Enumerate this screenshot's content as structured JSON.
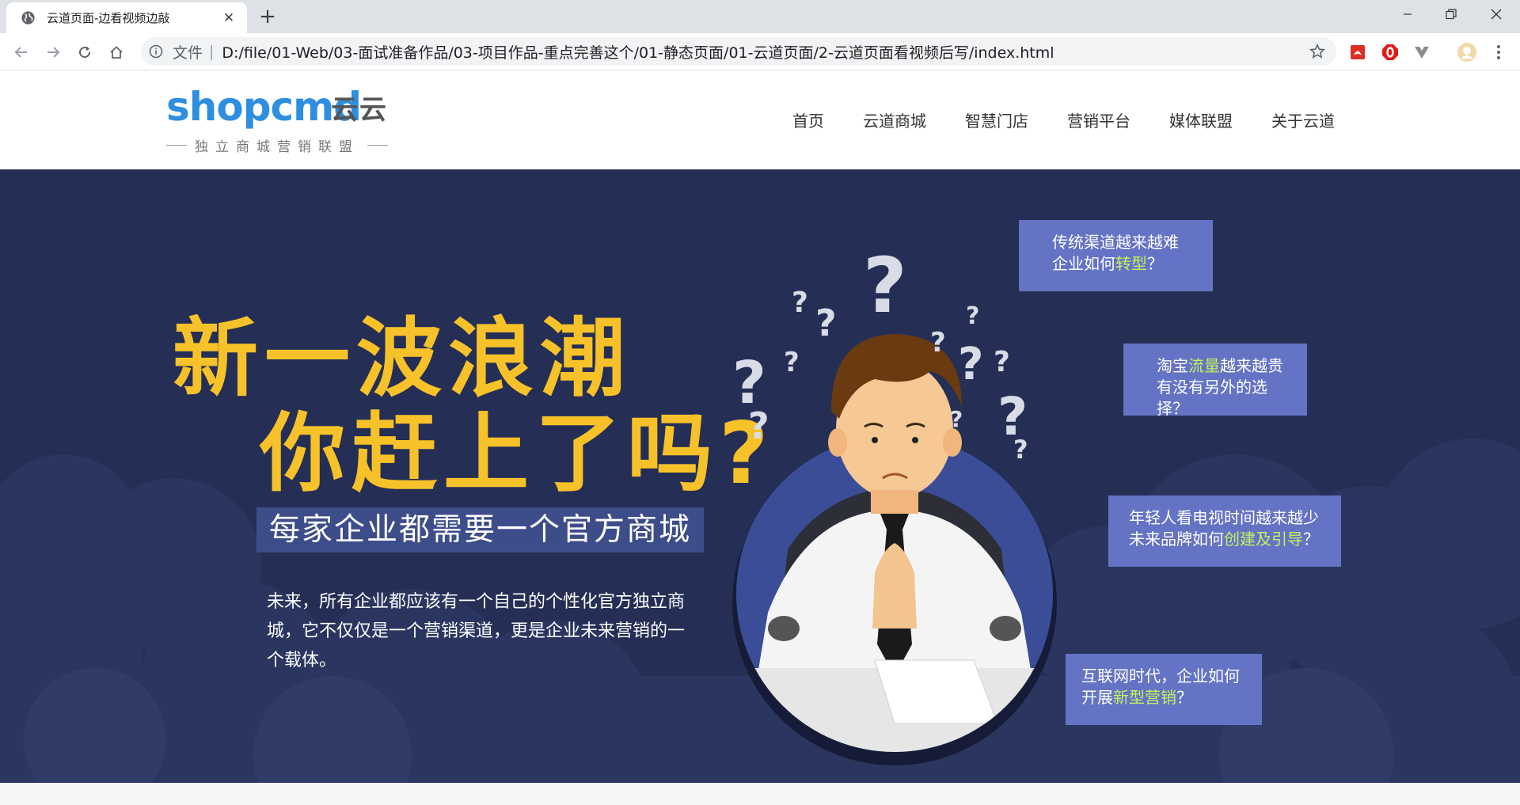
{
  "browser": {
    "tab": {
      "title": "云道页面-边看视频边敲"
    },
    "address": {
      "scheme_label": "文件",
      "url": "D:/file/01-Web/03-面试准备作品/03-项目作品-重点完善这个/01-静态页面/01-云道页面/2-云道页面看视频后写/index.html"
    }
  },
  "site": {
    "logo": {
      "text": "shopcmd",
      "chinese": "云云",
      "subtitle": "独立商城营销联盟"
    },
    "nav": [
      "首页",
      "云道商城",
      "智慧门店",
      "营销平台",
      "媒体联盟",
      "关于云道"
    ]
  },
  "hero": {
    "headline_line1": "新一波浪潮",
    "headline_line2": "你赶上了吗?",
    "tagline": "每家企业都需要一个官方商城",
    "description": "未来，所有企业都应该有一个自己的个性化官方独立商城，它不仅仅是一个营销渠道，更是企业未来营销的一个载体。",
    "bubbles": [
      {
        "line1": "传统渠道越来越难",
        "line2_pre": "企业如何",
        "line2_hl": "转型",
        "line2_post": "？"
      },
      {
        "line1_pre": "淘宝",
        "line1_hl": "流量",
        "line1_post": "越来越贵",
        "line2": "有没有另外的选择？"
      },
      {
        "line1": "年轻人看电视时间越来越少",
        "line2_pre": "未来品牌如何",
        "line2_hl": "创建及引导",
        "line2_post": "？"
      },
      {
        "line1": "互联网时代，企业如何",
        "line2_pre": "开展",
        "line2_hl": "新型营销",
        "line2_post": "？"
      }
    ]
  },
  "colors": {
    "hero_bg": "#252f55",
    "headline": "#f7c229",
    "bubble": "#6473c4",
    "highlight": "#c6f25e",
    "logo_blue": "#2e8ee0"
  }
}
